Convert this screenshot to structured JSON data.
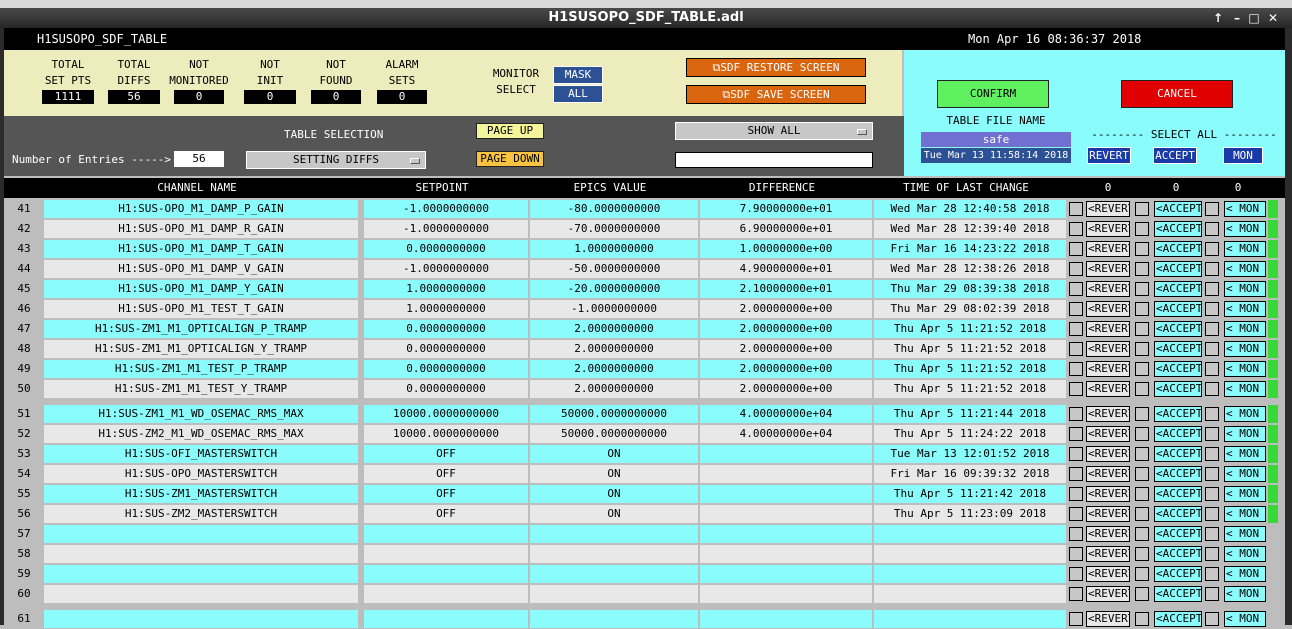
{
  "window": {
    "title": "H1SUSOPO_SDF_TABLE.adl",
    "controls": [
      "↑",
      "–",
      "□",
      "✕"
    ]
  },
  "appbar": {
    "screen_name": "H1SUSOPO_SDF_TABLE",
    "datetime": "Mon Apr 16 08:36:37 2018"
  },
  "summary": {
    "total_set_pts_label": "TOTAL\nSET PTS",
    "total_set_pts": "1111",
    "total_diffs_label": "TOTAL\nDIFFS",
    "total_diffs": "56",
    "not_monitored_label": "NOT\nMONITORED",
    "not_monitored": "0",
    "not_init_label": "NOT\nINIT",
    "not_init": "0",
    "not_found_label": "NOT\nFOUND",
    "not_found": "0",
    "alarm_sets_label": "ALARM\nSETS",
    "alarm_sets": "0",
    "monitor_select_label": "MONITOR\nSELECT",
    "mask_label": "MASK",
    "all_label": "ALL",
    "restore_label": "SDF RESTORE SCREEN",
    "save_label": "SDF SAVE SCREEN"
  },
  "controls": {
    "entries_label": "Number of Entries ----->",
    "entries_value": "56",
    "table_selection_label": "TABLE SELECTION",
    "table_selection_value": "SETTING DIFFS",
    "page_up": "PAGE UP",
    "page_down": "PAGE DOWN",
    "show_all": "SHOW ALL",
    "filter_value": ""
  },
  "right": {
    "confirm": "CONFIRM",
    "cancel": "CANCEL",
    "table_file_name_label": "TABLE FILE NAME",
    "file_name": "safe",
    "file_time": "Tue Mar 13 11:58:14 2018",
    "select_all_label": "-------- SELECT ALL --------",
    "revert": "REVERT",
    "accept": "ACCEPT",
    "mon": "MON"
  },
  "colors": {
    "cyan": "#8afcfc",
    "orange": "#d9660f",
    "green": "#38d838",
    "red": "#e00000",
    "blue": "#2c5295"
  },
  "table": {
    "headers": {
      "channel": "CHANNEL NAME",
      "setpoint": "SETPOINT",
      "epics": "EPICS VALUE",
      "difference": "DIFFERENCE",
      "time": "TIME OF LAST CHANGE",
      "count1": "0",
      "count2": "0",
      "count3": "0"
    },
    "row_buttons": {
      "revert": "<REVERT",
      "accept": "<ACCEPT",
      "mon": "< MON"
    },
    "rows": [
      {
        "n": "41",
        "channel": "H1:SUS-OPO_M1_DAMP_P_GAIN",
        "setpoint": "-1.0000000000",
        "epics": "-80.0000000000",
        "difference": "7.90000000e+01",
        "time": "Wed Mar 28 12:40:58 2018"
      },
      {
        "n": "42",
        "channel": "H1:SUS-OPO_M1_DAMP_R_GAIN",
        "setpoint": "-1.0000000000",
        "epics": "-70.0000000000",
        "difference": "6.90000000e+01",
        "time": "Wed Mar 28 12:39:40 2018"
      },
      {
        "n": "43",
        "channel": "H1:SUS-OPO_M1_DAMP_T_GAIN",
        "setpoint": "0.0000000000",
        "epics": "1.0000000000",
        "difference": "1.00000000e+00",
        "time": "Fri Mar 16 14:23:22 2018"
      },
      {
        "n": "44",
        "channel": "H1:SUS-OPO_M1_DAMP_V_GAIN",
        "setpoint": "-1.0000000000",
        "epics": "-50.0000000000",
        "difference": "4.90000000e+01",
        "time": "Wed Mar 28 12:38:26 2018"
      },
      {
        "n": "45",
        "channel": "H1:SUS-OPO_M1_DAMP_Y_GAIN",
        "setpoint": "1.0000000000",
        "epics": "-20.0000000000",
        "difference": "2.10000000e+01",
        "time": "Thu Mar 29 08:39:38 2018"
      },
      {
        "n": "46",
        "channel": "H1:SUS-OPO_M1_TEST_T_GAIN",
        "setpoint": "1.0000000000",
        "epics": "-1.0000000000",
        "difference": "2.00000000e+00",
        "time": "Thu Mar 29 08:02:39 2018"
      },
      {
        "n": "47",
        "channel": "H1:SUS-ZM1_M1_OPTICALIGN_P_TRAMP",
        "setpoint": "0.0000000000",
        "epics": "2.0000000000",
        "difference": "2.00000000e+00",
        "time": "Thu Apr  5 11:21:52 2018"
      },
      {
        "n": "48",
        "channel": "H1:SUS-ZM1_M1_OPTICALIGN_Y_TRAMP",
        "setpoint": "0.0000000000",
        "epics": "2.0000000000",
        "difference": "2.00000000e+00",
        "time": "Thu Apr  5 11:21:52 2018"
      },
      {
        "n": "49",
        "channel": "H1:SUS-ZM1_M1_TEST_P_TRAMP",
        "setpoint": "0.0000000000",
        "epics": "2.0000000000",
        "difference": "2.00000000e+00",
        "time": "Thu Apr  5 11:21:52 2018"
      },
      {
        "n": "50",
        "channel": "H1:SUS-ZM1_M1_TEST_Y_TRAMP",
        "setpoint": "0.0000000000",
        "epics": "2.0000000000",
        "difference": "2.00000000e+00",
        "time": "Thu Apr  5 11:21:52 2018"
      },
      {
        "n": "51",
        "channel": "H1:SUS-ZM1_M1_WD_OSEMAC_RMS_MAX",
        "setpoint": "10000.0000000000",
        "epics": "50000.0000000000",
        "difference": "4.00000000e+04",
        "time": "Thu Apr  5 11:21:44 2018"
      },
      {
        "n": "52",
        "channel": "H1:SUS-ZM2_M1_WD_OSEMAC_RMS_MAX",
        "setpoint": "10000.0000000000",
        "epics": "50000.0000000000",
        "difference": "4.00000000e+04",
        "time": "Thu Apr  5 11:24:22 2018"
      },
      {
        "n": "53",
        "channel": "H1:SUS-OFI_MASTERSWITCH",
        "setpoint": "OFF",
        "epics": "ON",
        "difference": "",
        "time": "Tue Mar 13 12:01:52 2018"
      },
      {
        "n": "54",
        "channel": "H1:SUS-OPO_MASTERSWITCH",
        "setpoint": "OFF",
        "epics": "ON",
        "difference": "",
        "time": "Fri Mar 16 09:39:32 2018"
      },
      {
        "n": "55",
        "channel": "H1:SUS-ZM1_MASTERSWITCH",
        "setpoint": "OFF",
        "epics": "ON",
        "difference": "",
        "time": "Thu Apr  5 11:21:42 2018"
      },
      {
        "n": "56",
        "channel": "H1:SUS-ZM2_MASTERSWITCH",
        "setpoint": "OFF",
        "epics": "ON",
        "difference": "",
        "time": "Thu Apr  5 11:23:09 2018"
      },
      {
        "n": "57",
        "channel": "",
        "setpoint": "",
        "epics": "",
        "difference": "",
        "time": ""
      },
      {
        "n": "58",
        "channel": "",
        "setpoint": "",
        "epics": "",
        "difference": "",
        "time": ""
      },
      {
        "n": "59",
        "channel": "",
        "setpoint": "",
        "epics": "",
        "difference": "",
        "time": ""
      },
      {
        "n": "60",
        "channel": "",
        "setpoint": "",
        "epics": "",
        "difference": "",
        "time": ""
      },
      {
        "n": "61",
        "channel": "",
        "setpoint": "",
        "epics": "",
        "difference": "",
        "time": ""
      }
    ]
  }
}
